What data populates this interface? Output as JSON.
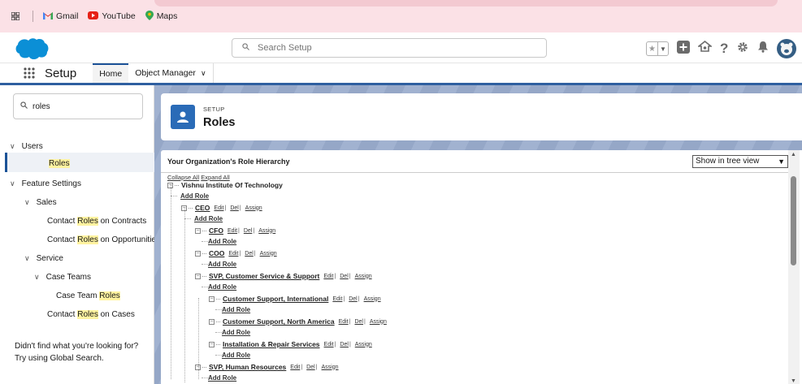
{
  "bookmarks": [
    {
      "label": "Gmail",
      "icon": "gmail-icon"
    },
    {
      "label": "YouTube",
      "icon": "youtube-icon"
    },
    {
      "label": "Maps",
      "icon": "maps-icon"
    }
  ],
  "header": {
    "search_placeholder": "Search Setup"
  },
  "nav": {
    "app_name": "Setup",
    "tabs": [
      "Home",
      "Object Manager"
    ]
  },
  "sidebar": {
    "quick_find_value": "roles",
    "highlight": "Roles",
    "users_label": "Users",
    "roles_label": "Roles",
    "feature_settings_label": "Feature Settings",
    "sales_label": "Sales",
    "contact_roles_contracts": {
      "pre": "Contact ",
      "post": " on Contracts"
    },
    "contact_roles_opportunities": {
      "pre": "Contact ",
      "post": " on Opportunities"
    },
    "service_label": "Service",
    "case_teams_label": "Case Teams",
    "case_team_roles": {
      "pre": "Case Team ",
      "post": ""
    },
    "contact_roles_cases": {
      "pre": "Contact ",
      "post": " on Cases"
    },
    "help_line1": "Didn't find what you're looking for?",
    "help_line2": "Try using Global Search."
  },
  "page": {
    "setup_label": "SETUP",
    "title": "Roles"
  },
  "hierarchy": {
    "title": "Your Organization's Role Hierarchy",
    "view_select": "Show in tree view",
    "collapse_all": "Collapse All",
    "expand_all": "Expand All",
    "root": "Vishnu Institute Of Technology",
    "add_role": "Add Role",
    "edit": "Edit",
    "del": "Del",
    "assign": "Assign",
    "roles": {
      "ceo": "CEO",
      "cfo": "CFO",
      "coo": "COO",
      "svp_cs": "SVP, Customer Service & Support",
      "cs_intl": "Customer Support, International",
      "cs_na": "Customer Support, North America",
      "install": "Installation & Repair Services",
      "svp_hr": "SVP, Human Resources"
    }
  }
}
